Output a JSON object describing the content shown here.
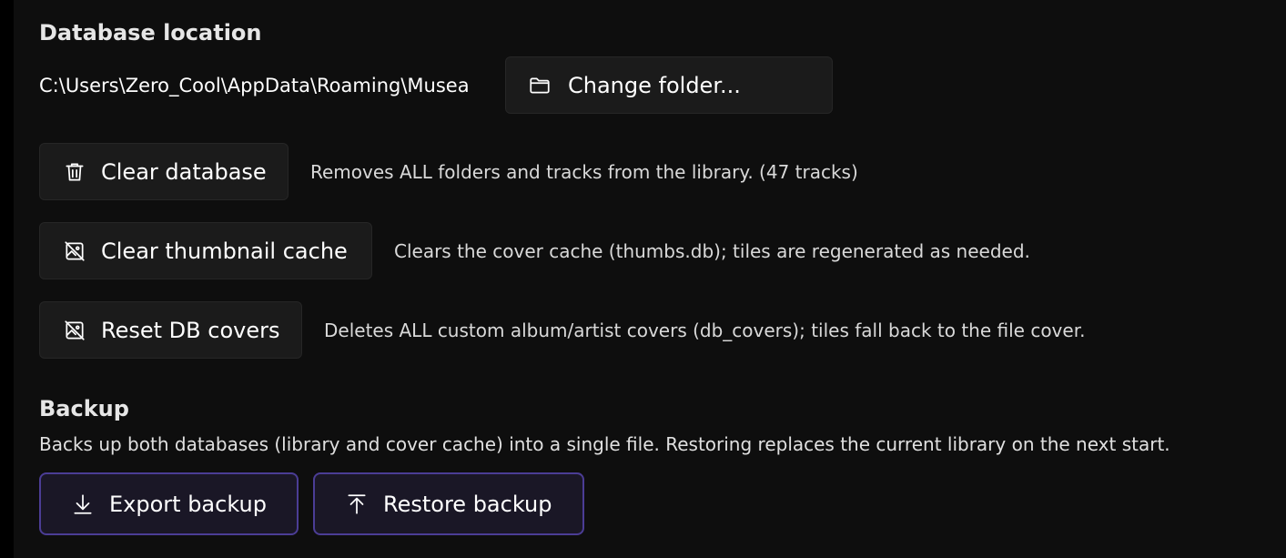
{
  "database_location": {
    "heading": "Database location",
    "path": "C:\\Users\\Zero_Cool\\AppData\\Roaming\\Musea",
    "change_folder_label": "Change folder..."
  },
  "maintenance": [
    {
      "label": "Clear database",
      "description": "Removes ALL folders and tracks from the library. (47 tracks)",
      "icon": "trash-icon"
    },
    {
      "label": "Clear thumbnail cache",
      "description": "Clears the cover cache (thumbs.db); tiles are regenerated as needed.",
      "icon": "image-off-icon"
    },
    {
      "label": "Reset DB covers",
      "description": "Deletes ALL custom album/artist covers (db_covers); tiles fall back to the file cover.",
      "icon": "image-off-icon"
    }
  ],
  "backup": {
    "heading": "Backup",
    "description": "Backs up both databases (library and cover cache) into a single file. Restoring replaces the current library on the next start.",
    "export_label": "Export backup",
    "restore_label": "Restore backup"
  },
  "colors": {
    "background": "#0e0e0e",
    "button": "#1b1b1b",
    "accent_border": "#4b3d95",
    "accent_fill": "#1a1726"
  }
}
